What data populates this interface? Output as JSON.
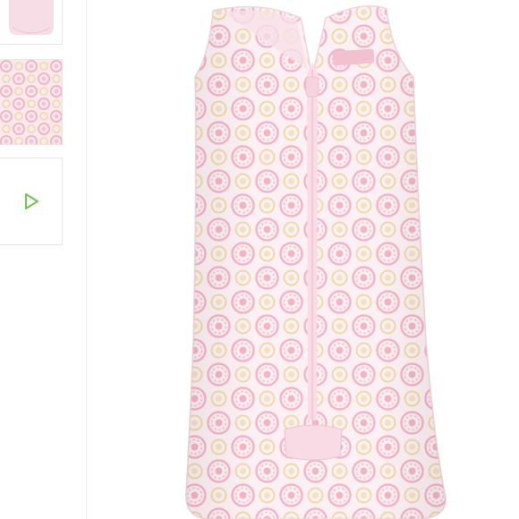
{
  "gallery": {
    "thumbnails": [
      {
        "icon": "sleep-sack-thumbnail",
        "selected": false
      },
      {
        "icon": "fabric-pattern-thumbnail",
        "selected": false
      },
      {
        "icon": "play-video-icon",
        "selected": false,
        "accent": "#6cc24a"
      }
    ],
    "main_image": {
      "icon": "pink-medallion-sleep-sack",
      "colors": {
        "base": "#fbe6ec",
        "pink": "#f2b5c6",
        "yellow": "#efd9a6",
        "zipper": "#f8dbe4"
      }
    }
  }
}
